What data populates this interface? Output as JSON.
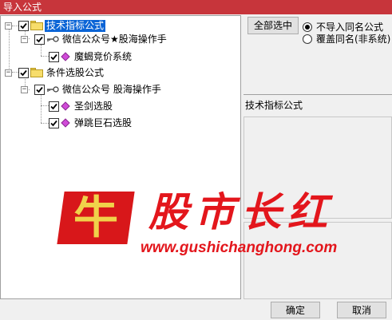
{
  "window": {
    "title": "导入公式"
  },
  "tree": {
    "nodes": [
      {
        "label": "技术指标公式",
        "type": "folder",
        "checked": true,
        "selected": true,
        "expanded": true
      },
      {
        "label": "微信公众号★股海操作手",
        "type": "key",
        "checked": true,
        "expanded": true
      },
      {
        "label": "魔蝎竞价系统",
        "type": "formula",
        "checked": true
      },
      {
        "label": "条件选股公式",
        "type": "folder",
        "checked": true,
        "expanded": true
      },
      {
        "label": "微信公众号 股海操作手",
        "type": "key",
        "checked": true,
        "expanded": true
      },
      {
        "label": "圣剑选股",
        "type": "formula",
        "checked": true
      },
      {
        "label": "弹跳巨石选股",
        "type": "formula",
        "checked": true
      }
    ]
  },
  "options": {
    "select_all_label": "全部选中",
    "radio": [
      {
        "label": "不导入同名公式",
        "selected": true
      },
      {
        "label": "覆盖同名(非系统)",
        "selected": false
      }
    ]
  },
  "detail": {
    "title": "技术指标公式"
  },
  "watermark": {
    "logo_char": "牛",
    "brand": "股市长红",
    "url": "www.gushichanghong.com",
    "color": "#e3161c"
  },
  "footer": {
    "ok_label": "确定",
    "cancel_label": "取消"
  },
  "colors": {
    "titlebar": "#c7353b",
    "selection": "#0a64d6"
  }
}
